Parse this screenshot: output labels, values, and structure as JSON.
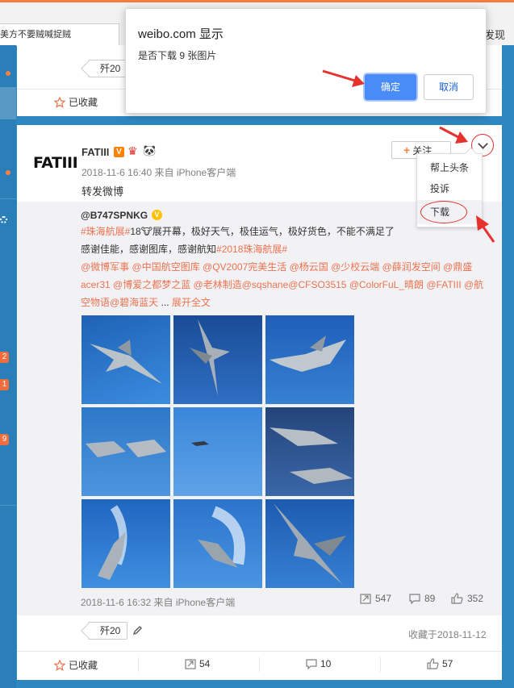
{
  "browser": {
    "search_text": "美方不要贼喊捉贼",
    "discover_label": "发现"
  },
  "sidebar": {
    "badges": [
      "2",
      "1",
      "9"
    ]
  },
  "prev_card": {
    "tag_label": "歼20",
    "collect_label": "已收藏"
  },
  "post": {
    "avatar_text": "FATIII",
    "username": "FATIII",
    "verified_badge": "V",
    "time_source": "2018-11-6 16:40 来自 iPhone客户端",
    "text": "转发微博",
    "follow_label": "关注",
    "menu": [
      "帮上头条",
      "投诉",
      "下载"
    ],
    "retweet": {
      "author": "@B747SPNKG",
      "lines": [
        {
          "parts": [
            {
              "t": "#珠海航展#",
              "link": true
            },
            {
              "t": "18🐮展开幕，极好天气，极佳运气，极好货色，不能不满足了",
              "link": false
            }
          ]
        },
        {
          "parts": [
            {
              "t": "感谢佳能，感谢图库，感谢航知",
              "link": false
            },
            {
              "t": "#2018珠海航展#",
              "link": true
            }
          ]
        },
        {
          "parts": [
            {
              "t": "@微博军事 @中国航空图库 @QV2007完美生活 @杨云国 @少校云端 @薛润发空间  @鼎盛",
              "link": true
            }
          ]
        },
        {
          "parts": [
            {
              "t": "acer31 @博爱之都梦之蓝 @老林制造@sqshane@CFSO3515 @ColorFuL_晴朗 @FATIII @航",
              "link": true
            }
          ]
        },
        {
          "parts": [
            {
              "t": "空物语@碧海蓝天",
              "link": true
            },
            {
              "t": " ... ",
              "link": false
            },
            {
              "t": "展开全文",
              "link": true
            }
          ]
        }
      ],
      "time_source": "2018-11-6 16:32 来自 iPhone客户端",
      "reposts": "547",
      "comments": "89",
      "likes": "352"
    },
    "tag_label": "歼20",
    "favorited_at": "收藏于2018-11-12",
    "actions": {
      "collect": "已收藏",
      "repost": "54",
      "comment": "10",
      "like": "57"
    }
  },
  "dialog": {
    "title": "weibo.com 显示",
    "message": "是否下载 9 张图片",
    "ok_label": "确定",
    "cancel_label": "取消"
  },
  "colors": {
    "accent": "#eb7350",
    "link": "#eb7350",
    "background": "#2e86c1",
    "ok_button": "#4a8cf7",
    "annotation": "#e5322d"
  }
}
